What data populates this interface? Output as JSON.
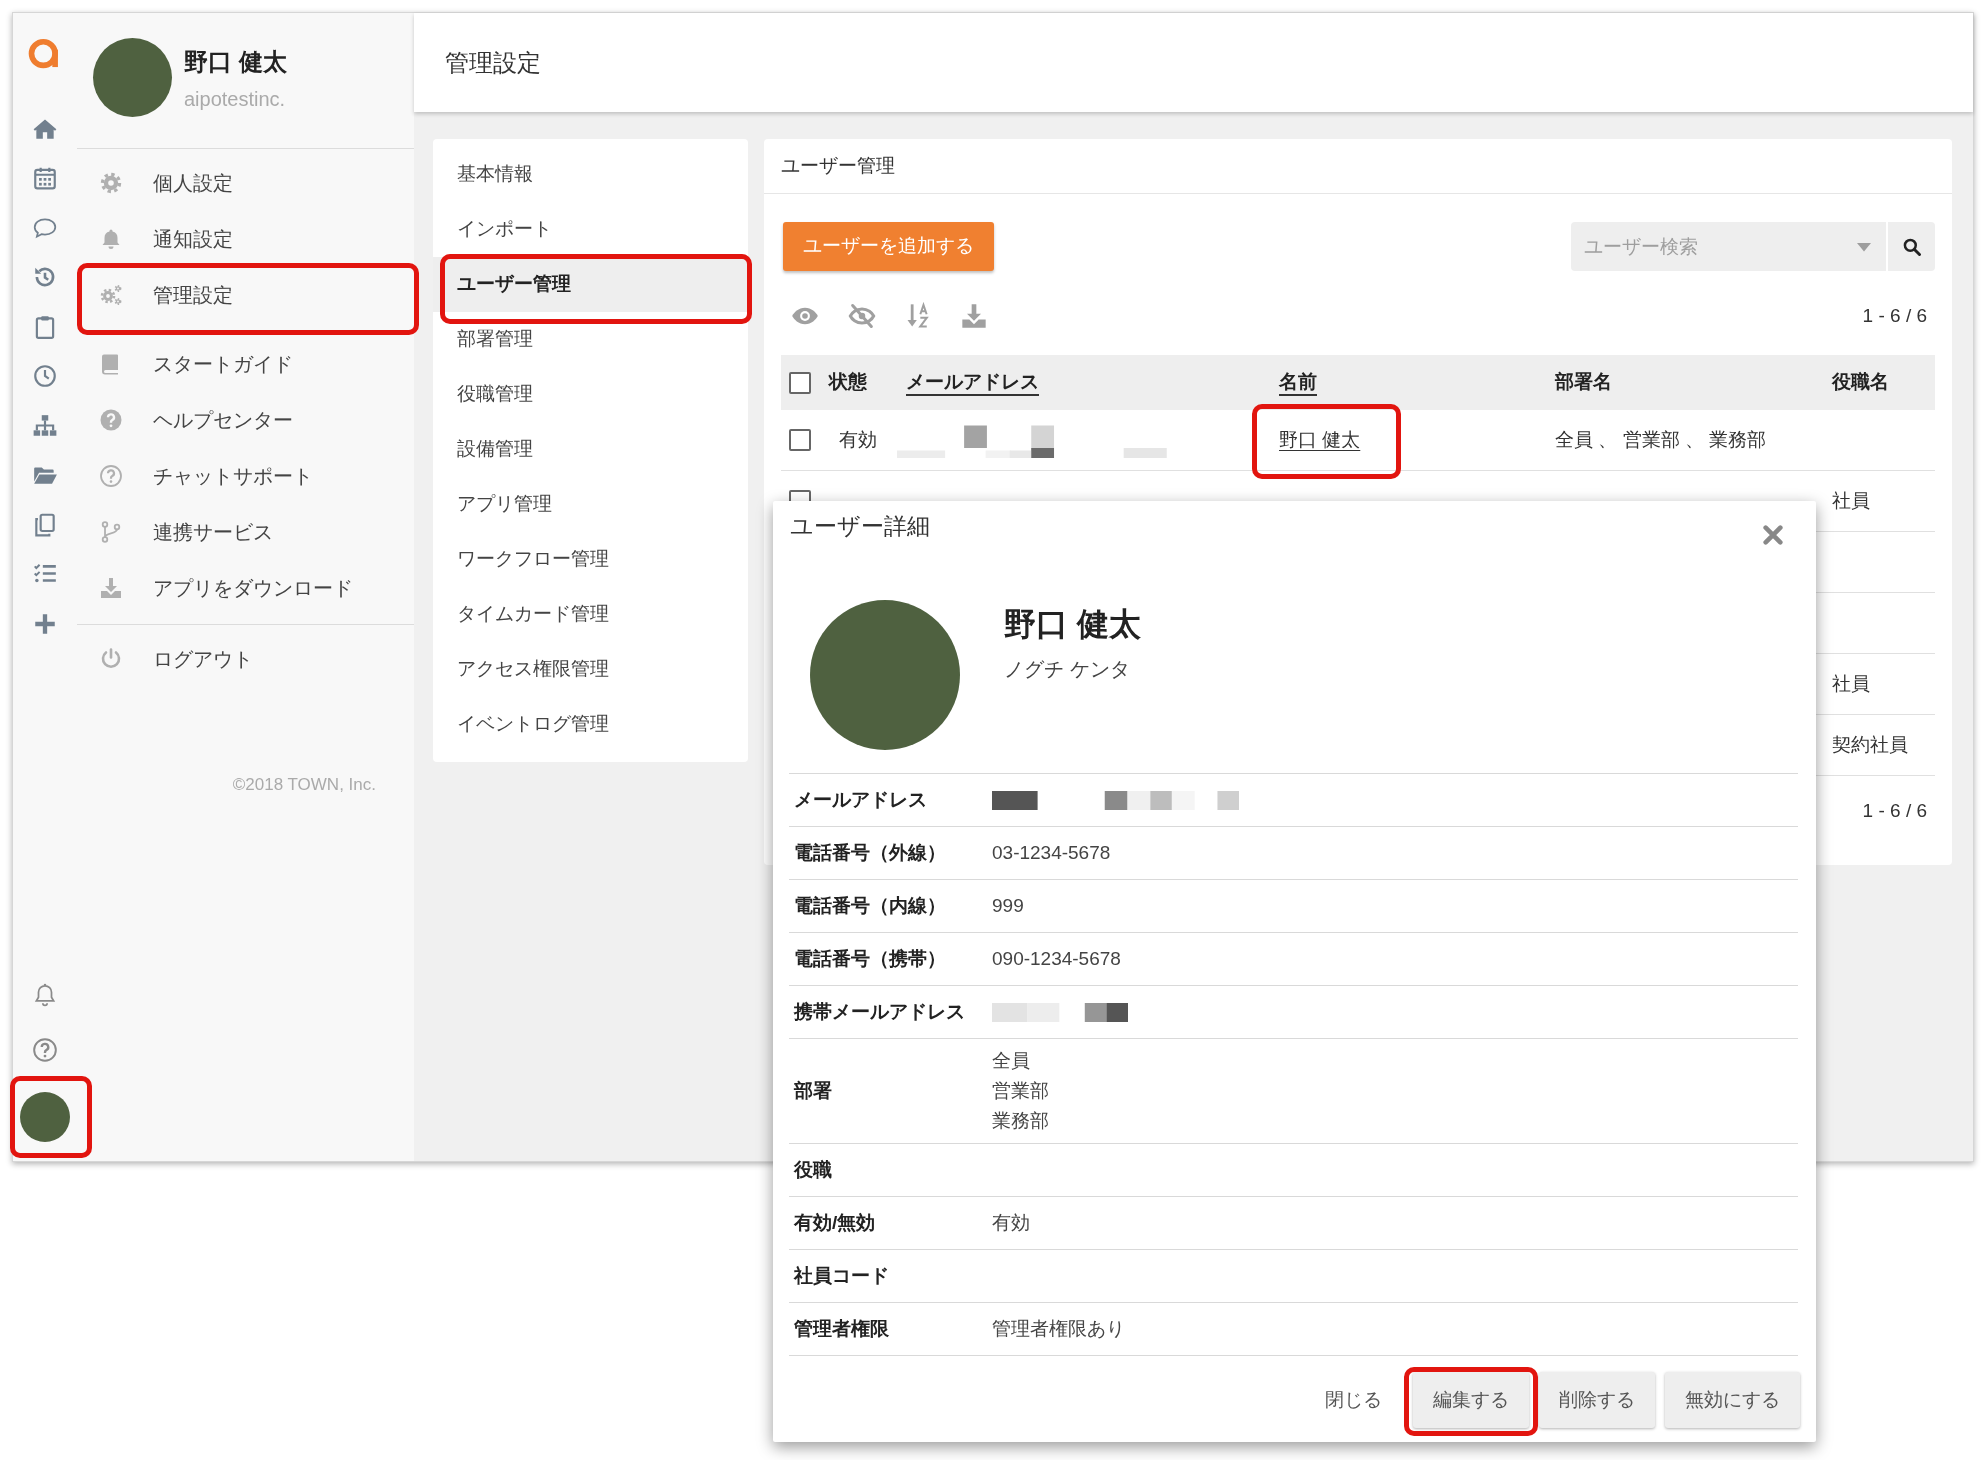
{
  "rail": {
    "avatar": {
      "highlighted": true
    }
  },
  "profile": {
    "name": "野口 健太",
    "organization": "aipotestinc."
  },
  "user_menu": {
    "sections": [
      {
        "divider_above": true,
        "items": [
          {
            "label": "個人設定",
            "highlighted": false
          },
          {
            "label": "通知設定",
            "highlighted": false
          },
          {
            "label": "管理設定",
            "highlighted": true
          }
        ]
      },
      {
        "divider_above": false,
        "items": [
          {
            "label": "スタートガイド",
            "highlighted": false
          },
          {
            "label": "ヘルプセンター",
            "highlighted": false
          },
          {
            "label": "チャットサポート",
            "highlighted": false
          },
          {
            "label": "連携サービス",
            "highlighted": false
          },
          {
            "label": "アプリをダウンロード",
            "highlighted": false
          }
        ]
      },
      {
        "divider_above": true,
        "items": [
          {
            "label": "ログアウト",
            "highlighted": false
          }
        ]
      }
    ],
    "copyright": "©2018 TOWN, Inc."
  },
  "header": {
    "title": "管理設定"
  },
  "admin_menu": {
    "items": [
      {
        "label": "基本情報",
        "selected": false,
        "highlighted": false
      },
      {
        "label": "インポート",
        "selected": false,
        "highlighted": false
      },
      {
        "label": "ユーザー管理",
        "selected": true,
        "highlighted": true
      },
      {
        "label": "部署管理",
        "selected": false,
        "highlighted": false
      },
      {
        "label": "役職管理",
        "selected": false,
        "highlighted": false
      },
      {
        "label": "設備管理",
        "selected": false,
        "highlighted": false
      },
      {
        "label": "アプリ管理",
        "selected": false,
        "highlighted": false
      },
      {
        "label": "ワークフロー管理",
        "selected": false,
        "highlighted": false
      },
      {
        "label": "タイムカード管理",
        "selected": false,
        "highlighted": false
      },
      {
        "label": "アクセス権限管理",
        "selected": false,
        "highlighted": false
      },
      {
        "label": "イベントログ管理",
        "selected": false,
        "highlighted": false
      }
    ]
  },
  "user_panel": {
    "title": "ユーザー管理",
    "add_button": "ユーザーを追加する",
    "search": {
      "placeholder": "ユーザー検索"
    },
    "pagination_top": "1 - 6 / 6",
    "table": {
      "select_all": {
        "checked": false
      },
      "columns": [
        {
          "label": "状態",
          "link": false
        },
        {
          "label": "メールアドレス",
          "link": true
        },
        {
          "label": "名前",
          "link": true
        },
        {
          "label": "部署名",
          "link": false
        },
        {
          "label": "役職名",
          "link": false
        }
      ],
      "rows": [
        {
          "checked": false,
          "status": "有効",
          "email_redacted": true,
          "name": "野口 健太",
          "name_highlighted": true,
          "departments": "全員 、 営業部 、 業務部"
        },
        {
          "checked": false,
          "role": "社員"
        },
        {},
        {},
        {
          "role": "社員"
        },
        {
          "role": "契約社員"
        }
      ]
    },
    "pagination_bottom": "1 - 6 / 6"
  },
  "dialog": {
    "title": "ユーザー詳細",
    "name": "野口 健太",
    "kana": "ノグチ ケンタ",
    "fields": [
      {
        "label": "メールアドレス",
        "value_redacted": true
      },
      {
        "label": "電話番号（外線）",
        "value": "03-1234-5678"
      },
      {
        "label": "電話番号（内線）",
        "value": "999"
      },
      {
        "label": "電話番号（携帯）",
        "value": "090-1234-5678"
      },
      {
        "label": "携帯メールアドレス",
        "value_redacted": true
      },
      {
        "label": "部署",
        "values": [
          "全員",
          "営業部",
          "業務部"
        ]
      },
      {
        "label": "役職"
      },
      {
        "label": "有効/無効",
        "value": "有効"
      },
      {
        "label": "社員コード"
      },
      {
        "label": "管理者権限",
        "value": "管理者権限あり"
      }
    ],
    "buttons": [
      {
        "label": "閉じる",
        "kind": "flat",
        "highlighted": false
      },
      {
        "label": "編集する",
        "kind": "raised",
        "highlighted": true
      },
      {
        "label": "削除する",
        "kind": "raised",
        "highlighted": false
      },
      {
        "label": "無効にする",
        "kind": "raised",
        "highlighted": false
      }
    ]
  }
}
